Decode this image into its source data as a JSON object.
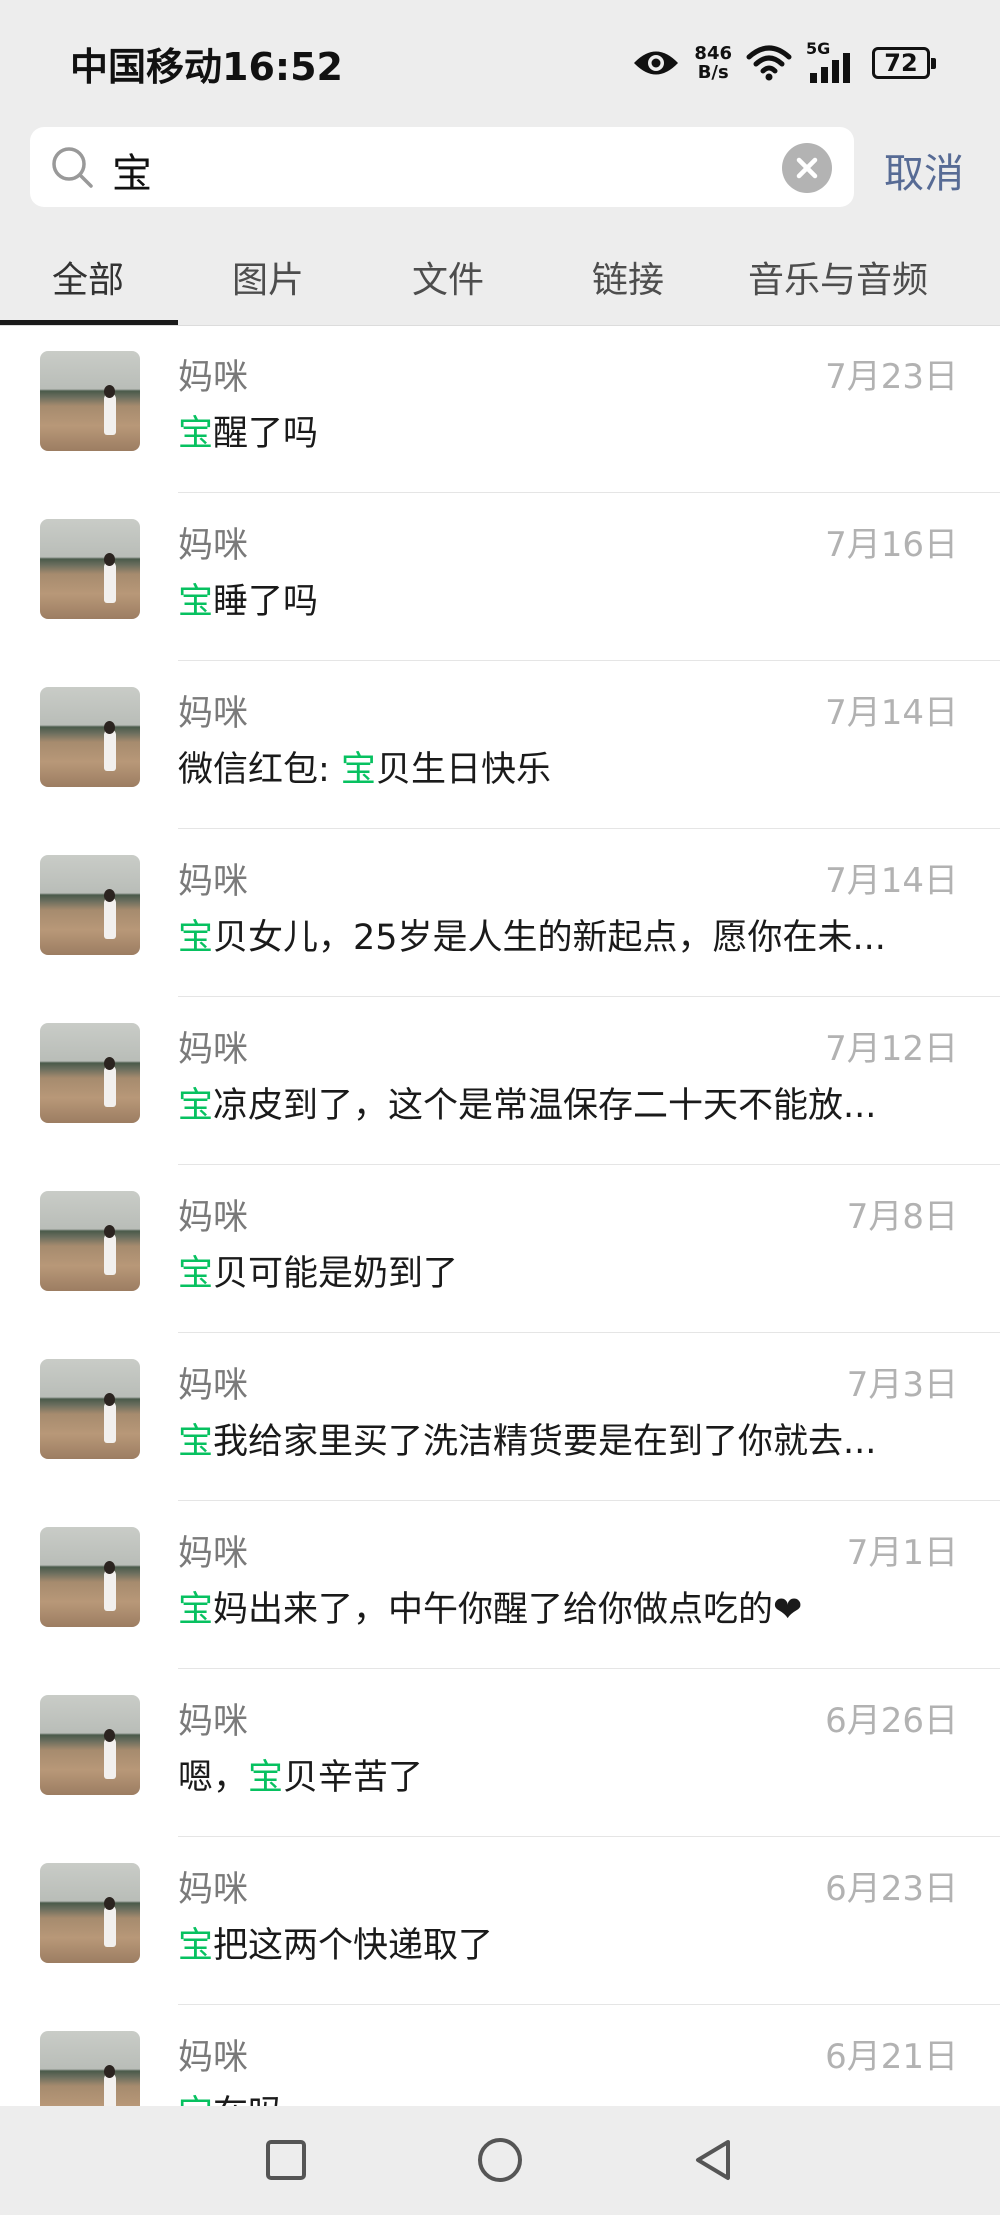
{
  "status_bar": {
    "carrier_time": "中国移动16:52",
    "net_speed_value": "846",
    "net_speed_unit": "B/s",
    "network": "5G",
    "battery": "72",
    "icons": [
      "eye-icon",
      "wifi-icon",
      "signal-icon",
      "battery-icon"
    ]
  },
  "search": {
    "query": "宝",
    "cancel_label": "取消",
    "icons": [
      "search-icon",
      "clear-icon"
    ]
  },
  "tabs": [
    {
      "label": "全部",
      "active": true
    },
    {
      "label": "图片",
      "active": false
    },
    {
      "label": "文件",
      "active": false
    },
    {
      "label": "链接",
      "active": false
    },
    {
      "label": "音乐与音频",
      "active": false
    }
  ],
  "accent_color": "#07c160",
  "results": [
    {
      "name": "妈咪",
      "date": "7月23日",
      "before": "",
      "highlight": "宝",
      "after": "醒了吗"
    },
    {
      "name": "妈咪",
      "date": "7月16日",
      "before": "",
      "highlight": "宝",
      "after": "睡了吗"
    },
    {
      "name": "妈咪",
      "date": "7月14日",
      "before": "微信红包: ",
      "highlight": "宝",
      "after": "贝生日快乐"
    },
    {
      "name": "妈咪",
      "date": "7月14日",
      "before": "",
      "highlight": "宝",
      "after": "贝女儿，25岁是人生的新起点，愿你在未..."
    },
    {
      "name": "妈咪",
      "date": "7月12日",
      "before": "",
      "highlight": "宝",
      "after": "凉皮到了，这个是常温保存二十天不能放..."
    },
    {
      "name": "妈咪",
      "date": "7月8日",
      "before": "",
      "highlight": "宝",
      "after": "贝可能是奶到了"
    },
    {
      "name": "妈咪",
      "date": "7月3日",
      "before": "",
      "highlight": "宝",
      "after": "我给家里买了洗洁精货要是在到了你就去..."
    },
    {
      "name": "妈咪",
      "date": "7月1日",
      "before": "",
      "highlight": "宝",
      "after": "妈出来了，中午你醒了给你做点吃的❤"
    },
    {
      "name": "妈咪",
      "date": "6月26日",
      "before": "嗯，",
      "highlight": "宝",
      "after": "贝辛苦了"
    },
    {
      "name": "妈咪",
      "date": "6月23日",
      "before": "",
      "highlight": "宝",
      "after": "把这两个快递取了"
    },
    {
      "name": "妈咪",
      "date": "6月21日",
      "before": "",
      "highlight": "宝",
      "after": "在吗"
    }
  ],
  "nav": [
    "recents-square-icon",
    "home-circle-icon",
    "back-triangle-icon"
  ]
}
